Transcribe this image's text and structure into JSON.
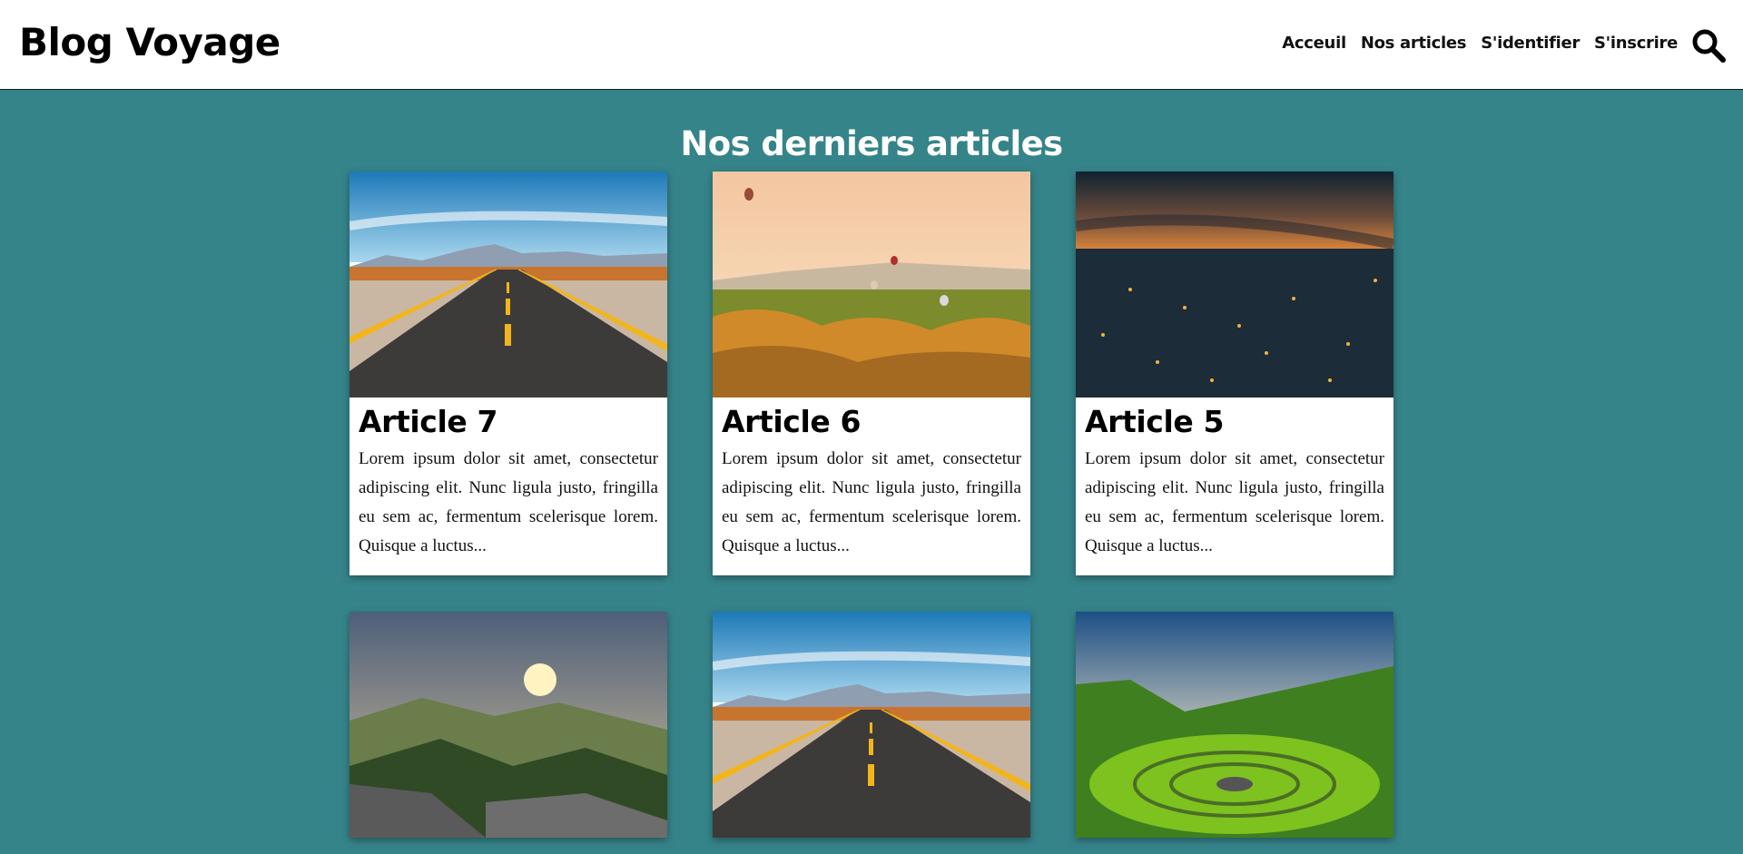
{
  "header": {
    "brand": "Blog Voyage",
    "nav": [
      "Acceuil",
      "Nos articles",
      "S'identifier",
      "S'inscrire"
    ],
    "search_icon": "search-icon"
  },
  "main": {
    "heading": "Nos derniers articles",
    "articles": [
      {
        "title": "Article 7",
        "excerpt": "Lorem ipsum dolor sit amet, consectetur adipiscing elit. Nunc ligula justo, fringilla eu sem ac, fermentum scelerisque lorem. Quisque a luctus...",
        "image": "desert-road"
      },
      {
        "title": "Article 6",
        "excerpt": "Lorem ipsum dolor sit amet, consectetur adipiscing elit. Nunc ligula justo, fringilla eu sem ac, fermentum scelerisque lorem. Quisque a luctus...",
        "image": "hot-air-balloons"
      },
      {
        "title": "Article 5",
        "excerpt": "Lorem ipsum dolor sit amet, consectetur adipiscing elit. Nunc ligula justo, fringilla eu sem ac, fermentum scelerisque lorem. Quisque a luctus...",
        "image": "city-dusk"
      },
      {
        "title": "",
        "excerpt": "",
        "image": "mountain-sunrise"
      },
      {
        "title": "",
        "excerpt": "",
        "image": "desert-road"
      },
      {
        "title": "",
        "excerpt": "",
        "image": "green-valley"
      }
    ]
  },
  "colors": {
    "page_background": "#35848a",
    "header_background": "#ffffff",
    "text_primary": "#000000"
  }
}
